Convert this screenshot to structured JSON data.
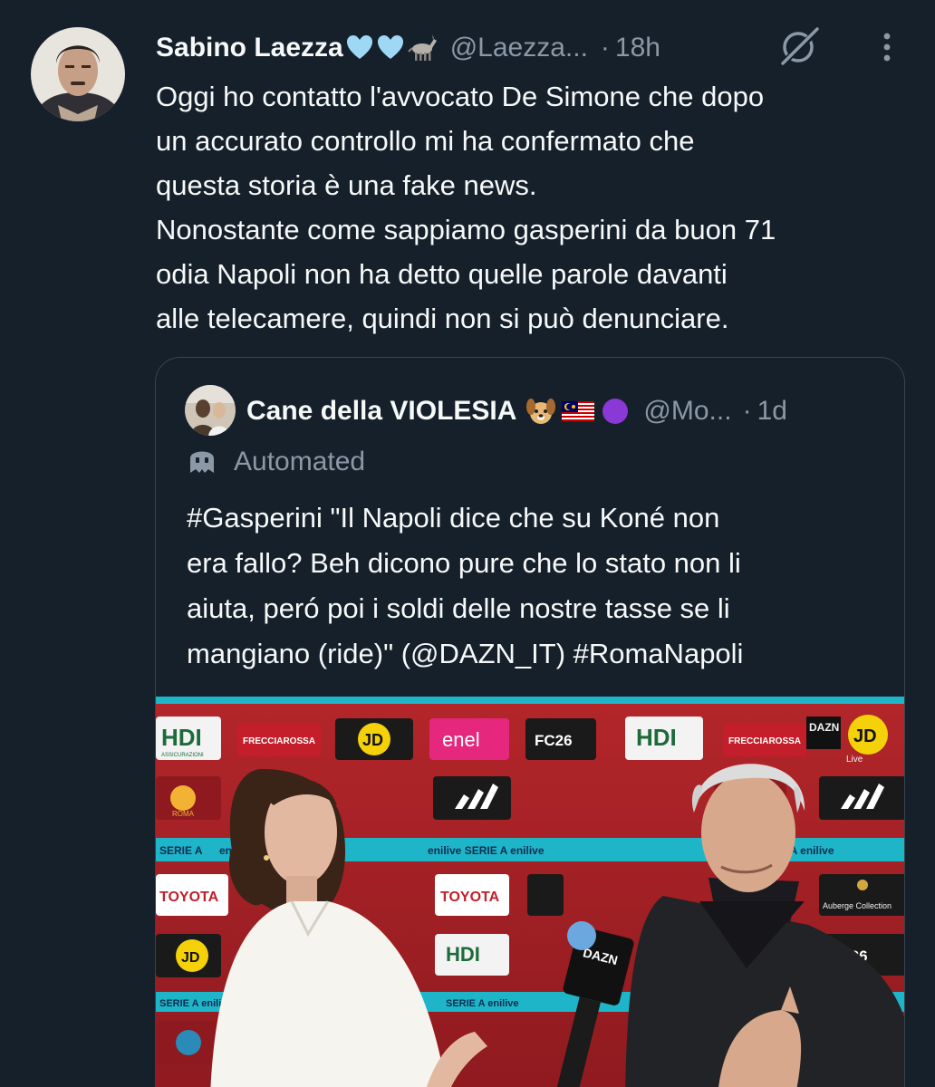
{
  "tweet": {
    "author": {
      "name": "Sabino Laezza",
      "handle": "@Laezza...",
      "time": "18h",
      "name_emojis": [
        "light-blue-heart",
        "light-blue-heart",
        "donkey"
      ]
    },
    "text_lines": [
      "Oggi ho contatto l'avvocato De Simone che dopo",
      "un accurato controllo mi ha confermato che",
      "questa storia è una fake news.",
      "Nonostante come sappiamo gasperini da buon 71",
      "odia Napoli non ha detto quelle parole davanti",
      "alle telecamere, quindi non si può denunciare."
    ],
    "icons": {
      "grok": "grok-icon",
      "more": "more-icon"
    }
  },
  "quote": {
    "author": {
      "name": "Cane della VIOLESIA",
      "handle": "@Mo...",
      "time": "1d",
      "name_emojis": [
        "dog-face",
        "flag-malaysia",
        "purple-circle"
      ]
    },
    "automated_label": "Automated",
    "text_lines": [
      "#Gasperini \"Il Napoli dice che su Koné non",
      "era fallo? Beh dicono pure che lo stato non li",
      "aiuta, peró poi i soldi delle nostre tasse se li",
      "mangiano (ride)\" (@DAZN_IT) #RomaNapoli"
    ],
    "media": {
      "sponsor_labels": [
        "HDI",
        "FRECCIAROSSA",
        "JD",
        "enel",
        "FC26",
        "TOYOTA",
        "Auberge Collection",
        "enilive",
        "SERIE A",
        "DAZN",
        "Live",
        "ASSICURAZIONI",
        "ROMA"
      ],
      "microphone_label": "DAZN"
    }
  },
  "colors": {
    "background": "#15202b",
    "text_primary": "#f7f9f9",
    "text_secondary": "#8b98a5",
    "border": "#38444d"
  }
}
